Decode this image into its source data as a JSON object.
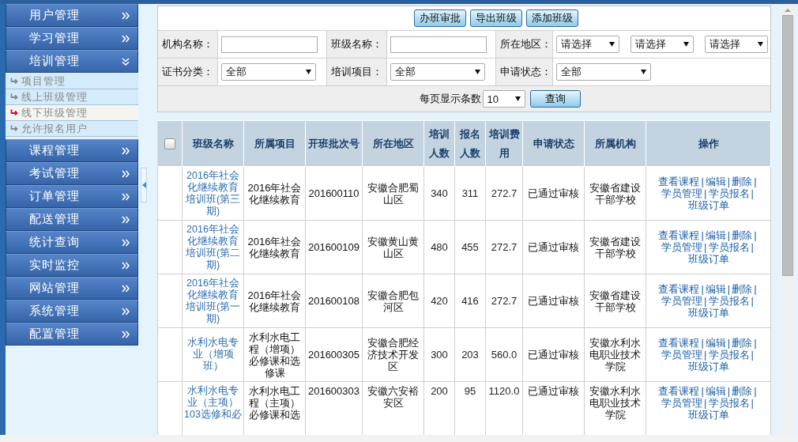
{
  "sidebar": {
    "menus": [
      {
        "label": "用户管理",
        "expanded": false
      },
      {
        "label": "学习管理",
        "expanded": false
      },
      {
        "label": "培训管理",
        "expanded": true,
        "children": [
          {
            "label": "项目管理",
            "selected": false
          },
          {
            "label": "线上班级管理",
            "selected": false
          },
          {
            "label": "线下班级管理",
            "selected": true
          },
          {
            "label": "允许报名用户",
            "selected": false
          }
        ]
      },
      {
        "label": "课程管理",
        "expanded": false
      },
      {
        "label": "考试管理",
        "expanded": false
      },
      {
        "label": "订单管理",
        "expanded": false
      },
      {
        "label": "配送管理",
        "expanded": false
      },
      {
        "label": "统计查询",
        "expanded": false
      },
      {
        "label": "实时监控",
        "expanded": false
      },
      {
        "label": "网站管理",
        "expanded": false
      },
      {
        "label": "系统管理",
        "expanded": false
      },
      {
        "label": "配置管理",
        "expanded": false
      }
    ]
  },
  "toolbar": {
    "buttons": [
      "办班审批",
      "导出班级",
      "添加班级"
    ]
  },
  "filters": [
    [
      {
        "label": "机构名称：",
        "controls": [
          {
            "kind": "text"
          }
        ]
      },
      {
        "label": "班级名称：",
        "controls": [
          {
            "kind": "text"
          }
        ]
      },
      {
        "label": "所在地区：",
        "controls": [
          {
            "kind": "select",
            "value": "请选择"
          },
          {
            "kind": "select",
            "value": "请选择"
          },
          {
            "kind": "select",
            "value": "请选择"
          }
        ]
      }
    ],
    [
      {
        "label": "证书分类：",
        "controls": [
          {
            "kind": "select",
            "value": "全部"
          }
        ]
      },
      {
        "label": "培训项目：",
        "controls": [
          {
            "kind": "select",
            "value": "全部"
          }
        ]
      },
      {
        "label": "申请状态：",
        "controls": [
          {
            "kind": "select",
            "value": "全部"
          }
        ]
      }
    ]
  ],
  "paging": {
    "label": "每页显示条数",
    "page_size": "10",
    "button": "查询"
  },
  "table": {
    "select_all_checked": false,
    "columns": [
      "班级名称",
      "所属项目",
      "开班批次号",
      "所在地区",
      "培训人数",
      "报名人数",
      "培训费用",
      "申请状态",
      "所属机构",
      "操作"
    ],
    "link_separator": "|",
    "rows": [
      {
        "name": "2016年社会化继续教育培训班(第三期)",
        "project": "2016年社会化继续教育",
        "batch": "201600110",
        "region": "安徽合肥蜀山区",
        "planned": "340",
        "enrolled": "311",
        "fee": "272.7",
        "status": "已通过审核",
        "org": "安徽省建设干部学校",
        "actions": [
          "查看课程",
          "编辑",
          "删除",
          "学员管理",
          "学员报名",
          "班级订单"
        ]
      },
      {
        "name": "2016年社会化继续教育培训班(第二期)",
        "project": "2016年社会化继续教育",
        "batch": "201600109",
        "region": "安徽黄山黄山区",
        "planned": "480",
        "enrolled": "455",
        "fee": "272.7",
        "status": "已通过审核",
        "org": "安徽省建设干部学校",
        "actions": [
          "查看课程",
          "编辑",
          "删除",
          "学员管理",
          "学员报名",
          "班级订单"
        ]
      },
      {
        "name": "2016年社会化继续教育培训班(第一期)",
        "project": "2016年社会化继续教育",
        "batch": "201600108",
        "region": "安徽合肥包河区",
        "planned": "420",
        "enrolled": "416",
        "fee": "272.7",
        "status": "已通过审核",
        "org": "安徽省建设干部学校",
        "actions": [
          "查看课程",
          "编辑",
          "删除",
          "学员管理",
          "学员报名",
          "班级订单"
        ]
      },
      {
        "name": "水利水电专业（增项班）",
        "project": "水利水电工程（增项）必修课和选修课",
        "batch": "201600305",
        "region": "安徽合肥经济技术开发区",
        "planned": "300",
        "enrolled": "203",
        "fee": "560.0",
        "status": "已通过审核",
        "org": "安徽水利水电职业技术学院",
        "actions": [
          "查看课程",
          "编辑",
          "删除",
          "学员管理",
          "学员报名",
          "班级订单"
        ]
      },
      {
        "name": "水利水电专业（主项）103选修和必",
        "project": "水利水电工程（主项）必修课和选",
        "batch": "201600303",
        "region": "安徽六安裕安区",
        "planned": "200",
        "enrolled": "95",
        "fee": "1120.0",
        "status": "已通过审核",
        "org": "安徽水利水电职业技术学院",
        "actions": [
          "查看课程",
          "编辑",
          "删除",
          "学员管理",
          "学员报名",
          "班级订单"
        ]
      }
    ]
  }
}
